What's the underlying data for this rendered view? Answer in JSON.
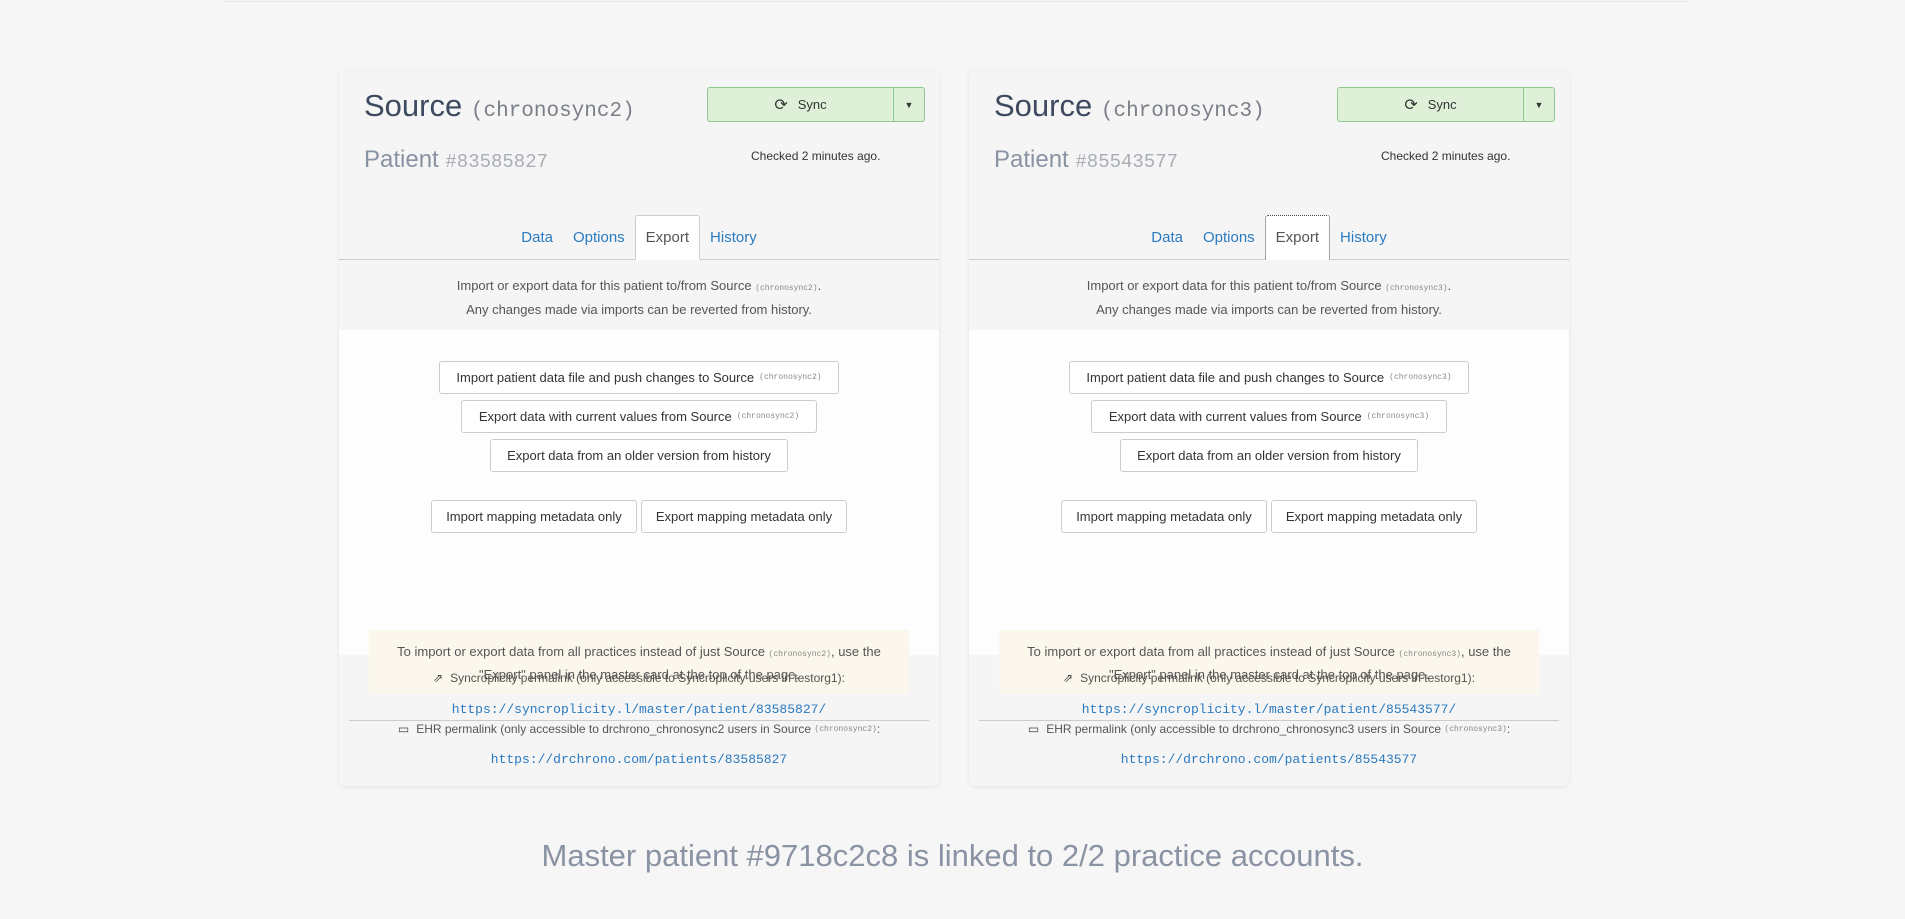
{
  "cards": [
    {
      "source_label": "Source",
      "source_code": "(chronosync2)",
      "source_code_short": "(chronosync2)",
      "patient_label": "Patient",
      "patient_number": "#83585827",
      "sync_label": "Sync",
      "checked_text": "Checked 2 minutes ago.",
      "tabs": [
        "Data",
        "Options",
        "Export",
        "History"
      ],
      "active_tab": "Export",
      "intro_line1": "Import or export data for this patient to/from Source",
      "intro_line2": "Any changes made via imports can be reverted from history.",
      "btn_import_push": "Import patient data file and push changes to Source",
      "btn_export_current": "Export data with current values from Source",
      "btn_export_older": "Export data from an older version from history",
      "btn_import_mapping": "Import mapping metadata only",
      "btn_export_mapping": "Export mapping metadata only",
      "notice_part1": "To import or export data from all practices instead of just Source",
      "notice_part2": ", use the \"Export\" panel in the master card at the top of the page.",
      "sync_permalink_label": "Syncroplicity permalink (only accessible to Syncroplicity users in testorg1):",
      "sync_permalink": "https://syncroplicity.l/master/patient/83585827/",
      "ehr_permalink_label": "EHR permalink (only accessible to drchrono_chronosync2 users in Source",
      "ehr_permalink": "https://drchrono.com/patients/83585827"
    },
    {
      "source_label": "Source",
      "source_code": "(chronosync3)",
      "source_code_short": "(chronosync3)",
      "patient_label": "Patient",
      "patient_number": "#85543577",
      "sync_label": "Sync",
      "checked_text": "Checked 2 minutes ago.",
      "tabs": [
        "Data",
        "Options",
        "Export",
        "History"
      ],
      "active_tab": "Export",
      "intro_line1": "Import or export data for this patient to/from Source",
      "intro_line2": "Any changes made via imports can be reverted from history.",
      "btn_import_push": "Import patient data file and push changes to Source",
      "btn_export_current": "Export data with current values from Source",
      "btn_export_older": "Export data from an older version from history",
      "btn_import_mapping": "Import mapping metadata only",
      "btn_export_mapping": "Export mapping metadata only",
      "notice_part1": "To import or export data from all practices instead of just Source",
      "notice_part2": ", use the \"Export\" panel in the master card at the top of the page.",
      "sync_permalink_label": "Syncroplicity permalink (only accessible to Syncroplicity users in testorg1):",
      "sync_permalink": "https://syncroplicity.l/master/patient/85543577/",
      "ehr_permalink_label": "EHR permalink (only accessible to drchrono_chronosync3 users in Source",
      "ehr_permalink": "https://drchrono.com/patients/85543577"
    }
  ],
  "master_text": "Master patient #9718c2c8 is linked to 2/2 practice accounts.",
  "colors": {
    "sync_bg": "#dff0d8",
    "link": "#2a7ac0",
    "notice_bg": "#fcf7ec"
  }
}
